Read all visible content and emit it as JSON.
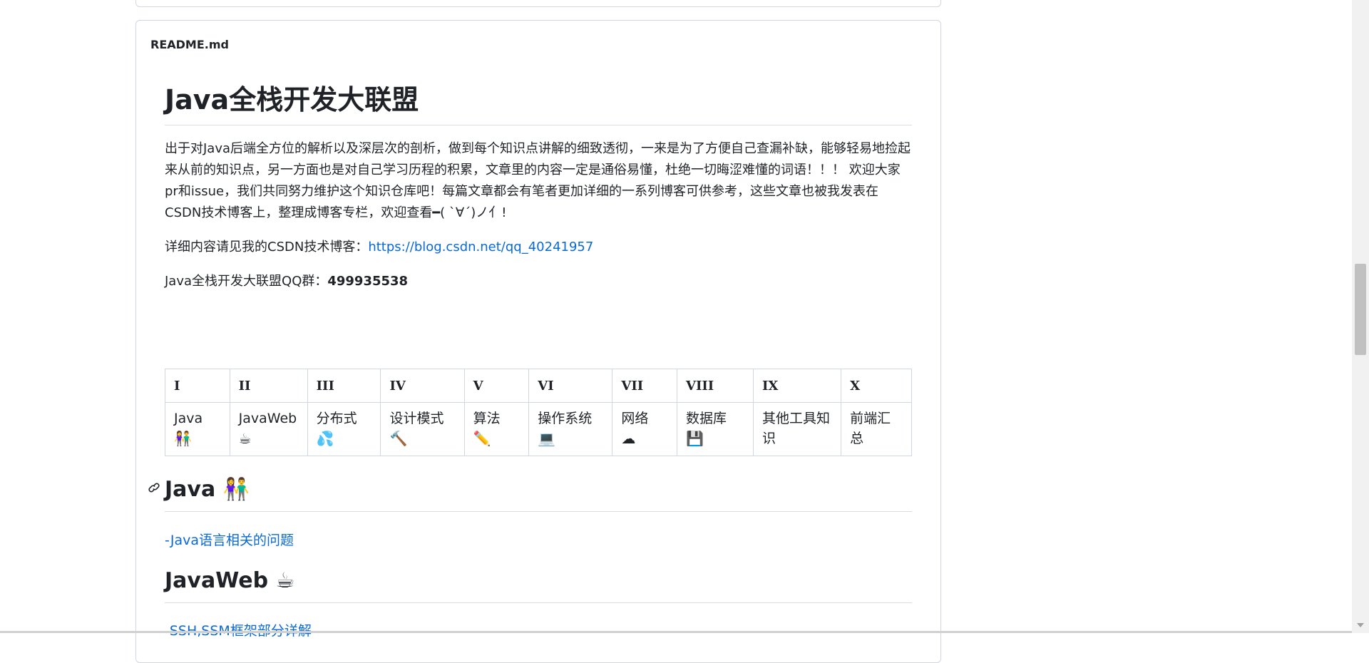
{
  "readme": {
    "file_name": "README.md",
    "title": "Java全栈开发大联盟",
    "intro": " 出于对Java后端全方位的解析以及深层次的剖析，做到每个知识点讲解的细致透彻，一来是为了方便自己查漏补缺，能够轻易地捡起来从前的知识点，另一方面也是对自己学习历程的积累，文章里的内容一定是通俗易懂，杜绝一切晦涩难懂的词语！！！ 欢迎大家pr和issue，我们共同努力维护这个知识仓库吧！每篇文章都会有笔者更加详细的一系列博客可供参考，这些文章也被我发表在CSDN技术博客上，整理成博客专栏，欢迎查看━( `∀´)ノ亻!",
    "blog_prefix": "详细内容请见我的CSDN技术博客：",
    "blog_link": "https://blog.csdn.net/qq_40241957",
    "qq_prefix": "Java全栈开发大联盟QQ群：",
    "qq_number": "499935538"
  },
  "nav_table": {
    "headers": [
      "I",
      "II",
      "III",
      "IV",
      "V",
      "VI",
      "VII",
      "VIII",
      "IX",
      "X"
    ],
    "cells": [
      {
        "label": "Java",
        "icon": "👫"
      },
      {
        "label": "JavaWeb",
        "icon": "☕"
      },
      {
        "label": "分布式",
        "icon": "💦"
      },
      {
        "label": "设计模式",
        "icon": "🔨"
      },
      {
        "label": "算法",
        "icon": "✏️"
      },
      {
        "label": "操作系统",
        "icon": "💻"
      },
      {
        "label": "网络",
        "icon": "☁"
      },
      {
        "label": "数据库",
        "icon": "💾"
      },
      {
        "label": "其他工具知识",
        "icon": ""
      },
      {
        "label": "前端汇总",
        "icon": ""
      }
    ]
  },
  "sections": [
    {
      "heading": "Java",
      "icon": "👫",
      "link": "-Java语言相关的问题"
    },
    {
      "heading": "JavaWeb",
      "icon": "☕",
      "link": "-SSH,SSM框架部分详解"
    }
  ]
}
